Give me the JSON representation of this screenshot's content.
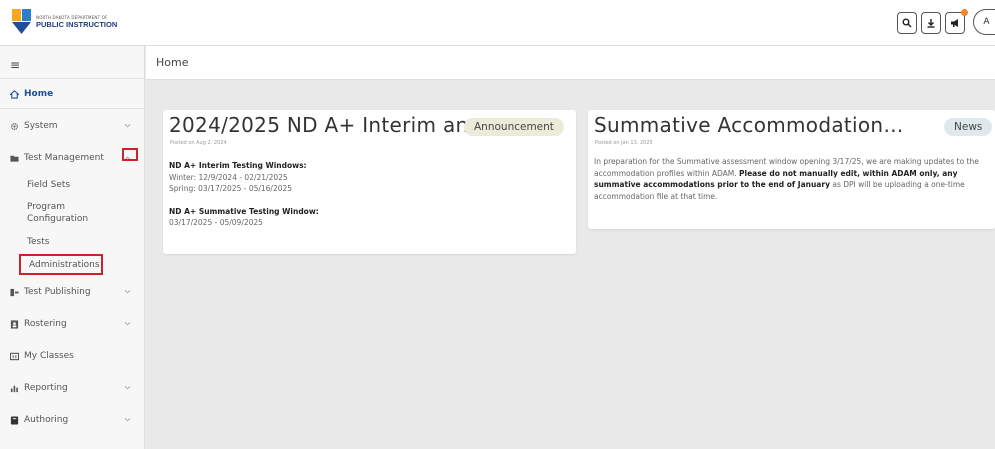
{
  "header": {
    "logo_small": "NORTH DAKOTA DEPARTMENT OF",
    "logo_big": "PUBLIC INSTRUCTION",
    "avatar_initial": "A"
  },
  "colors": {
    "accent": "#1e4f9c",
    "highlight": "#d0202e",
    "notification": "#f08a24"
  },
  "sidebar": {
    "menu_icon": "hamburger-icon",
    "items": [
      {
        "label": "Home",
        "icon": "home-icon"
      },
      {
        "label": "System",
        "icon": "gear-icon"
      },
      {
        "label": "Test Management",
        "icon": "folder-icon"
      },
      {
        "label": "Test Publishing",
        "icon": "publish-icon"
      },
      {
        "label": "Rostering",
        "icon": "roster-icon"
      },
      {
        "label": "My Classes",
        "icon": "classes-icon"
      },
      {
        "label": "Reporting",
        "icon": "chart-icon"
      },
      {
        "label": "Authoring",
        "icon": "book-icon"
      }
    ],
    "sub_items": [
      "Field Sets",
      "Program Configuration",
      "Tests",
      "Administrations"
    ]
  },
  "breadcrumb": "Home",
  "cards": [
    {
      "title": "2024/2025 ND A+ Interim an…",
      "posted": "Posted on Aug 2, 2024",
      "badge": "Announcement",
      "heading1": "ND A+ Interim Testing Windows:",
      "line1": "Winter: 12/9/2024 - 02/21/2025",
      "line2": "Spring: 03/17/2025 - 05/16/2025",
      "heading2": "ND A+ Summative Testing Window:",
      "line3": "03/17/2025 - 05/09/2025"
    },
    {
      "title": "Summative Accommodation…",
      "posted": "Posted on Jan 13, 2025",
      "badge": "News",
      "text_a": "In preparation for the Summative assessment window opening 3/17/25, we are making updates to the accommodation profiles within ADAM. ",
      "text_b": "Please do not manually edit, within ADAM only, any summative accommodations prior to the end of January",
      "text_c": " as DPI will be uploading a one-time accommodation file at that time."
    }
  ]
}
